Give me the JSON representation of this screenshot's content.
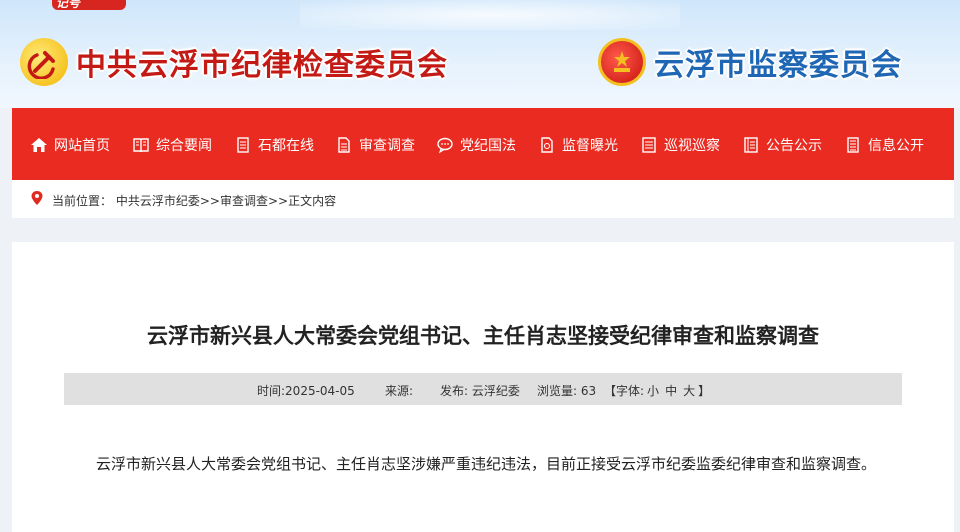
{
  "header": {
    "corner_watermark": "记号",
    "left_title": "中共云浮市纪律检查委员会",
    "right_title": "云浮市监察委员会"
  },
  "nav": {
    "items": [
      {
        "label": "网站首页",
        "icon": "home-icon"
      },
      {
        "label": "综合要闻",
        "icon": "book-icon"
      },
      {
        "label": "石都在线",
        "icon": "document-icon"
      },
      {
        "label": "审查调查",
        "icon": "file-icon"
      },
      {
        "label": "党纪国法",
        "icon": "chat-icon"
      },
      {
        "label": "监督曝光",
        "icon": "page-icon"
      },
      {
        "label": "巡视巡察",
        "icon": "list-icon"
      },
      {
        "label": "公告公示",
        "icon": "notice-icon"
      },
      {
        "label": "信息公开",
        "icon": "info-icon"
      }
    ]
  },
  "breadcrumb": {
    "prefix": "当前位置：",
    "home": "中共云浮市纪委",
    "sep1": ">>",
    "section": "审查调查",
    "sep2": ">>",
    "current": "正文内容"
  },
  "article": {
    "title": "云浮市新兴县人大常委会党组书记、主任肖志坚接受纪律审查和监察调查",
    "time": "时间:2025-04-05",
    "source": "来源:",
    "publisher": "发布: 云浮纪委",
    "views": "浏览量: 63",
    "font_prefix": "【字体:",
    "font_small": "小",
    "font_medium": "中",
    "font_large": "大",
    "font_suffix": "】",
    "body": "云浮市新兴县人大常委会党组书记、主任肖志坚涉嫌严重违纪违法，目前正接受云浮市纪委监委纪律审查和监察调查。"
  },
  "colors": {
    "nav_bg": "#ea2b22",
    "left_title": "#c41a15",
    "right_title": "#1f67b4"
  }
}
